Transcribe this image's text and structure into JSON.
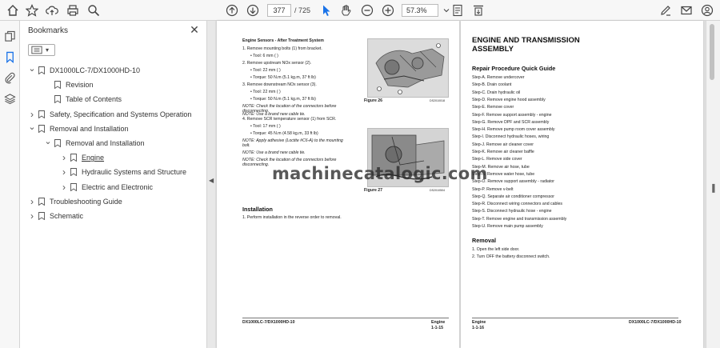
{
  "toolbar": {
    "page_current": "377",
    "page_total": "/ 725",
    "zoom": "57.3%"
  },
  "bookmarks": {
    "title": "Bookmarks",
    "items": [
      {
        "label": "DX1000LC-7/DX1000HD-10",
        "caret": "v"
      },
      {
        "label": "Revision",
        "caret": ""
      },
      {
        "label": "Table of Contents",
        "caret": ""
      },
      {
        "label": "Safety, Specification and Systems Operation",
        "caret": ">"
      },
      {
        "label": "Removal and Installation",
        "caret": "v"
      },
      {
        "label": "Removal and Installation",
        "caret": "v"
      },
      {
        "label": "Engine",
        "caret": ">"
      },
      {
        "label": "Hydraulic Systems and Structure",
        "caret": ">"
      },
      {
        "label": "Electric and Electronic",
        "caret": ">"
      },
      {
        "label": "Troubleshooting Guide",
        "caret": ">"
      },
      {
        "label": "Schematic",
        "caret": ">"
      }
    ]
  },
  "left_page": {
    "heading": "Engine Sensors - After Treatment System",
    "lines": [
      "1.    Remove mounting bolts (1) from bracket.",
      "•   Tool: 6 mm (         )",
      "2.    Remove upstream NOx sensor (2).",
      "•   Tool: 22 mm (         )",
      "•   Torque: 50 N.m (5.1 kg.m, 37 ft lb)",
      "3.    Remove downstream NOx sensor (3).",
      "•   Tool: 22 mm (         )",
      "•   Torque: 50 N.m (5.1 kg.m, 37 ft lb)",
      "NOTE:     Check the location of the connectors before",
      "               disconnecting.",
      "4.    Remove SCR temperature sensor (1) from SCR.",
      "•   Tool: 17 mm (         )",
      "•   Torque: 45 N.m (4.58 kg.m, 33 ft lb)",
      "NOTE:     Apply adhesive (Loctite #C6-A) to the mounting",
      "               bolt.",
      "NOTE:     Use a brand new cable tie.",
      "NOTE:     Check the location of the connectors before",
      "               disconnecting."
    ],
    "note1": "NOTE:     Use a brand new cable tie.",
    "figure26": "Figure 26",
    "figure27": "Figure 27",
    "fig26_code": "DS2010018",
    "fig27_code": "DS2010504",
    "install_heading": "Installation",
    "install_line": "1.    Perform installation in the reverse order to removal.",
    "footer_left": "DX1000LC-7/DX1000HD-10",
    "footer_right_1": "Engine",
    "footer_right_2": "1-1-15"
  },
  "right_page": {
    "title_1": "ENGINE AND TRANSMISSION",
    "title_2": "ASSEMBLY",
    "quick_heading": "Repair Procedure Quick Guide",
    "steps": [
      "Step-A. Remove undercover",
      "Step-B. Drain coolant",
      "Step-C. Drain hydraulic oil",
      "Step-D. Remove engine hood assembly",
      "Step-E. Remove cover",
      "Step-F. Remove support assembly - engine",
      "Step-G. Remove DPF and SCR assembly",
      "Step-H. Remove pump room cover assembly",
      "Step-I. Disconnect hydraulic hoses, wiring",
      "Step-J. Remove air cleaner cover",
      "Step-K. Remove air cleaner baffle",
      "Step-L. Remove side cover",
      "Step-M. Remove air hose, tube",
      "Step-N. Remove water hose, tube",
      "Step-O. Remove support assembly - radiator",
      "Step-P. Remove v-belt",
      "Step-Q. Separate air conditioner compressor",
      "Step-R. Disconnect wiring connectors and cables",
      "Step-S. Disconnect hydraulic hose - engine",
      "Step-T. Remove engine and transmission assembly",
      "Step-U. Remove main pump assembly"
    ],
    "removal_heading": "Removal",
    "removal_lines": [
      "1.    Open the left side door.",
      "2.    Turn OFF the battery disconnect switch."
    ],
    "footer_left_1": "Engine",
    "footer_left_2": "1-1-16",
    "footer_right": "DX1000LC-7/DX1000HD-10"
  },
  "watermark": "machinecatalogic.com"
}
